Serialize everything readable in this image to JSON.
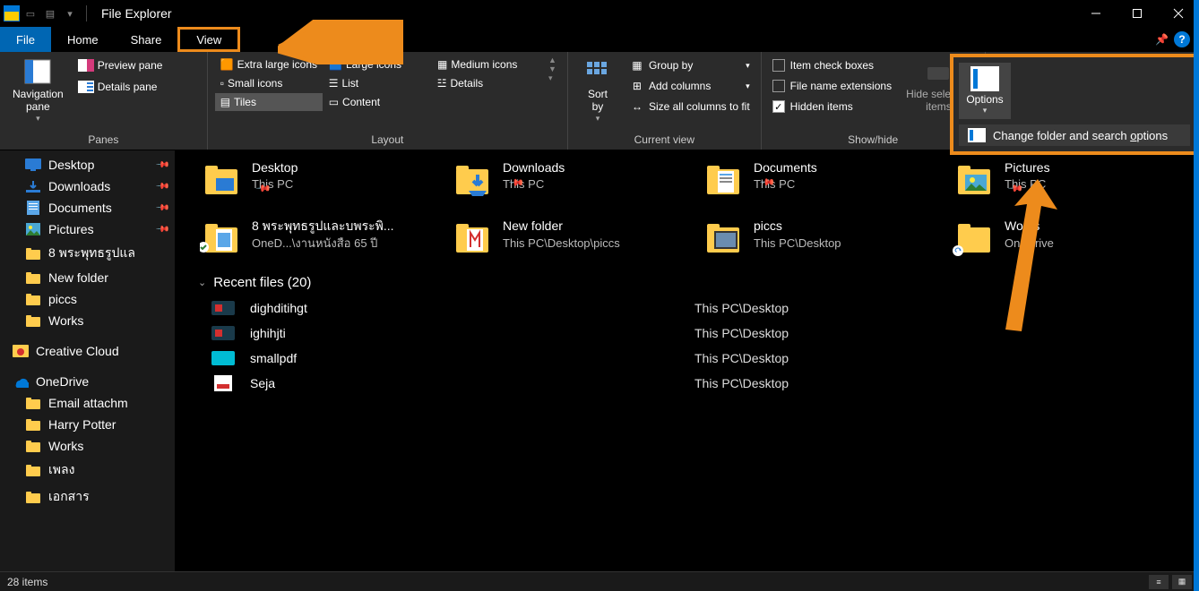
{
  "window": {
    "title": "File Explorer"
  },
  "tabs": {
    "file": "File",
    "home": "Home",
    "share": "Share",
    "view": "View"
  },
  "ribbon": {
    "panes": {
      "label": "Panes",
      "navigation": "Navigation\npane",
      "preview": "Preview pane",
      "details": "Details pane"
    },
    "layout": {
      "label": "Layout",
      "extra_large": "Extra large icons",
      "large": "Large icons",
      "medium": "Medium icons",
      "small": "Small icons",
      "list": "List",
      "details": "Details",
      "tiles": "Tiles",
      "content": "Content"
    },
    "current_view": {
      "label": "Current view",
      "sort_by": "Sort\nby",
      "group_by": "Group by",
      "add_columns": "Add columns",
      "size_all": "Size all columns to fit"
    },
    "show_hide": {
      "label": "Show/hide",
      "item_check": "Item check boxes",
      "file_ext": "File name extensions",
      "hidden": "Hidden items",
      "hide_selected": "Hide selected\nitems"
    },
    "options": {
      "label": "Options",
      "change": "Change folder and search options"
    }
  },
  "sidebar": [
    {
      "label": "Desktop",
      "icon": "desktop",
      "pinned": true
    },
    {
      "label": "Downloads",
      "icon": "downloads",
      "pinned": true
    },
    {
      "label": "Documents",
      "icon": "documents",
      "pinned": true
    },
    {
      "label": "Pictures",
      "icon": "pictures",
      "pinned": true
    },
    {
      "label": "8 พระพุทธรูปแล",
      "icon": "folder",
      "pinned": false
    },
    {
      "label": "New folder",
      "icon": "folder",
      "pinned": false
    },
    {
      "label": "piccs",
      "icon": "folder",
      "pinned": false
    },
    {
      "label": "Works",
      "icon": "folder",
      "pinned": false
    }
  ],
  "sidebar2": [
    {
      "label": "Creative Cloud",
      "icon": "cc",
      "root": true
    }
  ],
  "sidebar3": [
    {
      "label": "OneDrive",
      "icon": "onedrive",
      "root": true
    },
    {
      "label": "Email attachm",
      "icon": "folder"
    },
    {
      "label": "Harry Potter",
      "icon": "folder"
    },
    {
      "label": "Works",
      "icon": "folder"
    },
    {
      "label": "เพลง",
      "icon": "folder"
    },
    {
      "label": "เอกสาร",
      "icon": "folder"
    }
  ],
  "tiles": [
    {
      "name": "Desktop",
      "sub": "This PC",
      "pinned": true,
      "icon": "desktop-folder"
    },
    {
      "name": "Downloads",
      "sub": "This PC",
      "pinned": true,
      "icon": "downloads-folder"
    },
    {
      "name": "Documents",
      "sub": "This PC",
      "pinned": true,
      "icon": "documents-folder"
    },
    {
      "name": "Pictures",
      "sub": "This PC",
      "pinned": true,
      "icon": "pictures-folder"
    },
    {
      "name": "8 พระพุทธรูปและบพระพิ...",
      "sub": "OneD...\\งานหนังสือ 65 ปี",
      "pinned": false,
      "icon": "sync-folder"
    },
    {
      "name": "New folder",
      "sub": "This PC\\Desktop\\piccs",
      "pinned": false,
      "icon": "m-folder"
    },
    {
      "name": "piccs",
      "sub": "This PC\\Desktop",
      "pinned": false,
      "icon": "pic-folder"
    },
    {
      "name": "Works",
      "sub": "OneDrive",
      "pinned": false,
      "icon": "sync-folder2"
    }
  ],
  "recent": {
    "header": "Recent files (20)",
    "rows": [
      {
        "name": "dighditihgt",
        "path": "This PC\\Desktop"
      },
      {
        "name": "ighihjti",
        "path": "This PC\\Desktop"
      },
      {
        "name": "smallpdf",
        "path": "This PC\\Desktop"
      },
      {
        "name": "Seja",
        "path": "This PC\\Desktop"
      }
    ]
  },
  "status": {
    "items": "28 items"
  }
}
